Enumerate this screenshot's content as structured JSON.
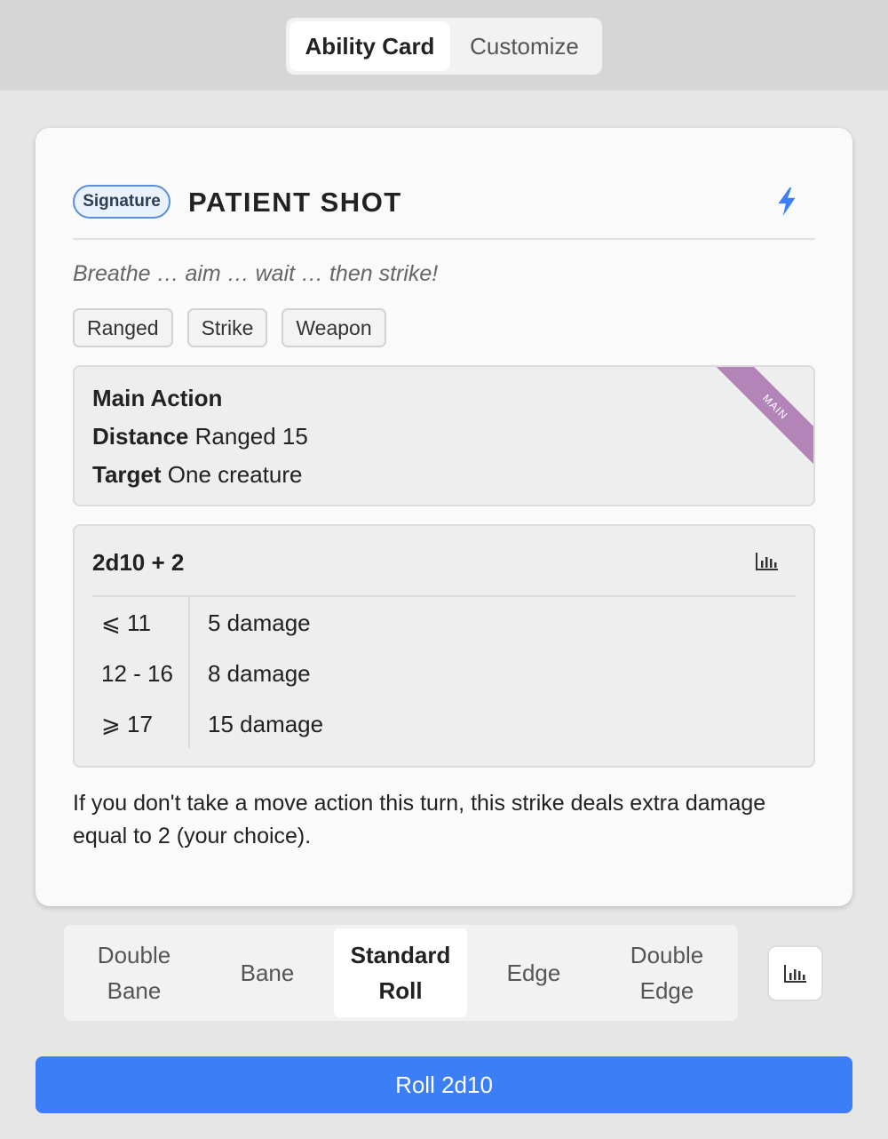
{
  "tabs": {
    "ability_card": "Ability Card",
    "customize": "Customize"
  },
  "ability": {
    "badge": "Signature",
    "name": "PATIENT SHOT",
    "flavor": "Breathe … aim … wait … then strike!",
    "keywords": [
      "Ranged",
      "Strike",
      "Weapon"
    ],
    "action_type": "Main Action",
    "distance_label": "Distance",
    "distance_value": "Ranged 15",
    "target_label": "Target",
    "target_value": "One creature",
    "ribbon": "MAIN",
    "roll_formula": "2d10 + 2",
    "tiers": [
      {
        "range": "⩽ 11",
        "result": "5 damage"
      },
      {
        "range": "12 - 16",
        "result": "8 damage"
      },
      {
        "range": "⩾ 17",
        "result": "15 damage"
      }
    ],
    "effect": "If you don't take a move action this turn, this strike deals extra damage equal to 2 (your choice)."
  },
  "roll_options": {
    "double_bane": [
      "Double",
      "Bane"
    ],
    "bane": "Bane",
    "standard": [
      "Standard",
      "Roll"
    ],
    "edge": "Edge",
    "double_edge": [
      "Double",
      "Edge"
    ],
    "selected": "standard"
  },
  "roll_button": "Roll 2d10",
  "icons": {
    "header": "lightning-bolt-icon",
    "stats": "bar-chart-icon"
  },
  "colors": {
    "accent": "#3b7ef6",
    "ribbon": "#b384b8",
    "badge_border": "#5b8fd8"
  }
}
